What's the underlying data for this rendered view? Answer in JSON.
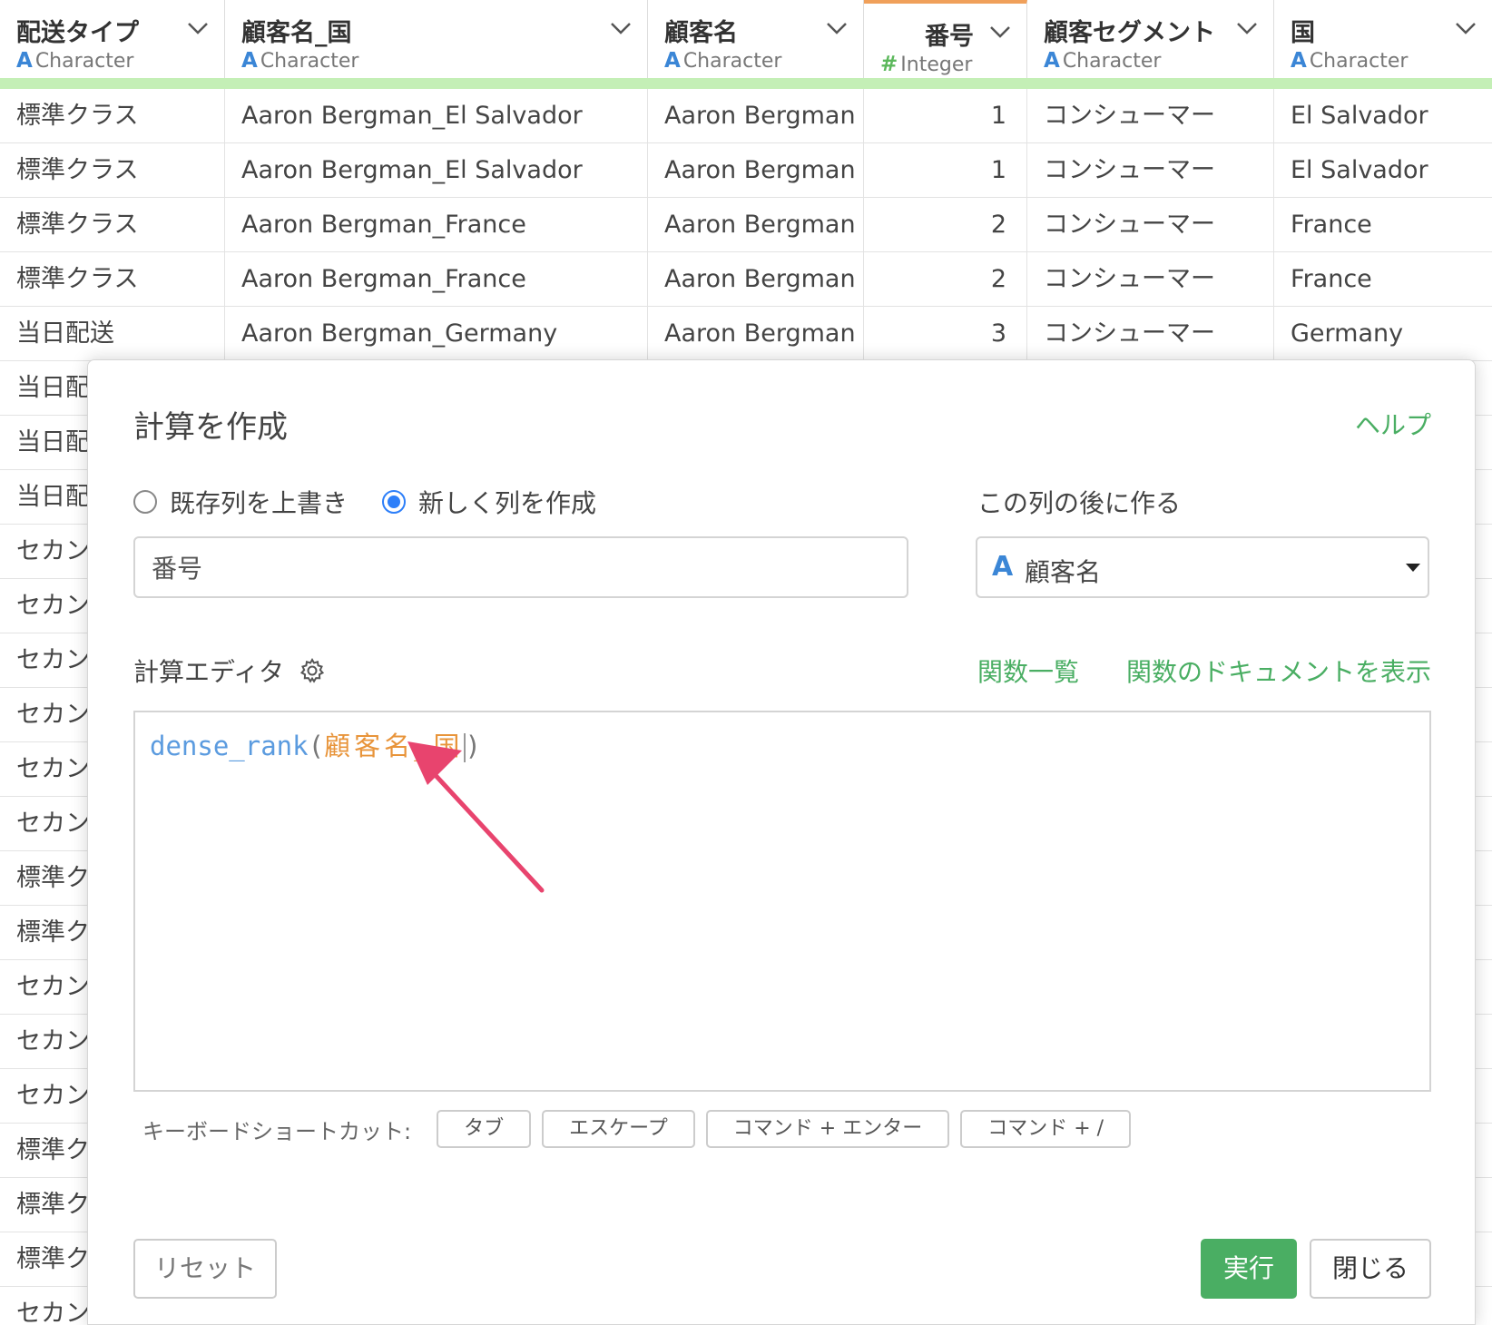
{
  "grid": {
    "headers": [
      {
        "name": "配送タイプ",
        "type": "Character",
        "type_icon": "A"
      },
      {
        "name": "顧客名_国",
        "type": "Character",
        "type_icon": "A"
      },
      {
        "name": "顧客名",
        "type": "Character",
        "type_icon": "A"
      },
      {
        "name": "番号",
        "type": "Integer",
        "type_icon": "#"
      },
      {
        "name": "顧客セグメント",
        "type": "Character",
        "type_icon": "A"
      },
      {
        "name": "国",
        "type": "Character",
        "type_icon": "A"
      }
    ],
    "rows": [
      [
        "標準クラス",
        "Aaron Bergman_El Salvador",
        "Aaron Bergman",
        "1",
        "コンシューマー",
        "El Salvador"
      ],
      [
        "標準クラス",
        "Aaron Bergman_El Salvador",
        "Aaron Bergman",
        "1",
        "コンシューマー",
        "El Salvador"
      ],
      [
        "標準クラス",
        "Aaron Bergman_France",
        "Aaron Bergman",
        "2",
        "コンシューマー",
        "France"
      ],
      [
        "標準クラス",
        "Aaron Bergman_France",
        "Aaron Bergman",
        "2",
        "コンシューマー",
        "France"
      ],
      [
        "当日配送",
        "Aaron Bergman_Germany",
        "Aaron Bergman",
        "3",
        "コンシューマー",
        "Germany"
      ],
      [
        "当日配",
        "",
        "",
        "",
        "",
        ""
      ],
      [
        "当日配",
        "",
        "",
        "",
        "",
        ""
      ],
      [
        "当日配",
        "",
        "",
        "",
        "",
        ""
      ],
      [
        "セカン",
        "",
        "",
        "",
        "",
        ""
      ],
      [
        "セカン",
        "",
        "",
        "",
        "",
        ""
      ],
      [
        "セカン",
        "",
        "",
        "",
        "",
        ""
      ],
      [
        "セカン",
        "",
        "",
        "",
        "",
        ""
      ],
      [
        "セカン",
        "",
        "",
        "",
        "",
        ""
      ],
      [
        "セカン",
        "",
        "",
        "",
        "",
        ""
      ],
      [
        "標準ク",
        "",
        "",
        "",
        "",
        ""
      ],
      [
        "標準ク",
        "",
        "",
        "",
        "",
        ""
      ],
      [
        "セカン",
        "",
        "",
        "",
        "",
        ""
      ],
      [
        "セカン",
        "",
        "",
        "",
        "",
        ""
      ],
      [
        "セカン",
        "",
        "",
        "",
        "",
        ""
      ],
      [
        "標準ク",
        "",
        "",
        "",
        "",
        ""
      ],
      [
        "標準ク",
        "",
        "",
        "",
        "",
        ""
      ],
      [
        "標準ク",
        "",
        "",
        "",
        "",
        ""
      ],
      [
        "セカン",
        "",
        "",
        "",
        "",
        ""
      ]
    ]
  },
  "modal": {
    "title": "計算を作成",
    "help": "ヘルプ",
    "radio_overwrite": "既存列を上書き",
    "radio_new": "新しく列を作成",
    "radio_selected": "new",
    "column_name_value": "番号",
    "after_label": "この列の後に作る",
    "after_column_icon": "A",
    "after_column": "顧客名",
    "editor_label": "計算エディタ",
    "function_list": "関数一覧",
    "function_docs": "関数のドキュメントを表示",
    "code": {
      "fn": "dense_rank",
      "open": "(",
      "arg": "顧客名_国",
      "close": ")"
    },
    "shortcuts_label": "キーボードショートカット:",
    "shortcuts": [
      "タブ",
      "エスケープ",
      "コマンド + エンター",
      "コマンド + /"
    ],
    "reset_button": "リセット",
    "run_button": "実行",
    "close_button": "閉じる"
  },
  "colors": {
    "accent_green": "#4aae63",
    "type_blue": "#3b86d6",
    "code_orange": "#e8943a",
    "arrow_pink": "#e8446e",
    "header_underline": "#c4efb6"
  }
}
